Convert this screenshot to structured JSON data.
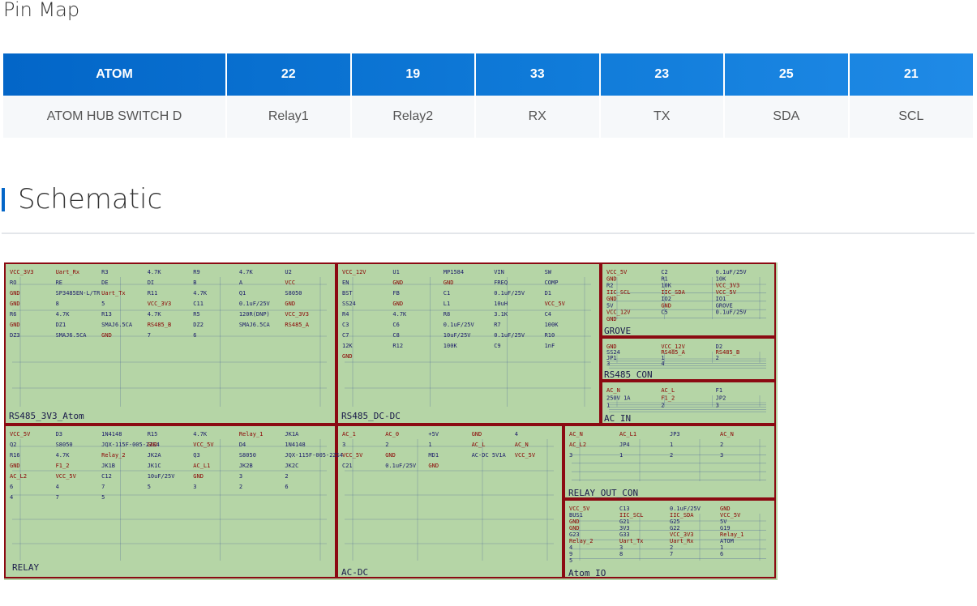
{
  "pin_map": {
    "title": "Pin Map",
    "headers": [
      "ATOM",
      "22",
      "19",
      "33",
      "23",
      "25",
      "21"
    ],
    "row": [
      "ATOM HUB SWITCH D",
      "Relay1",
      "Relay2",
      "RX",
      "TX",
      "SDA",
      "SCL"
    ]
  },
  "schematic_section": {
    "heading": "Schematic"
  },
  "colors": {
    "accent": "#0366c8",
    "schematic_bg": "#b5d5a6",
    "schematic_border": "#8b0a12",
    "wire": "#0a1f8f",
    "net_label": "#8b0000"
  },
  "schematic": {
    "rs485_3v3": {
      "title": "RS485_3V3_Atom",
      "labels": [
        "VCC_3V3",
        "Uart_Rx",
        "R3",
        "4.7K",
        "R9",
        "4.7K",
        "U2",
        "RO",
        "RE",
        "DE",
        "DI",
        "B",
        "A",
        "VCC",
        "GND",
        "SP3485EN-L/TR",
        "Uart_Tx",
        "R11",
        "4.7K",
        "Q1",
        "S8050",
        "GND",
        "8",
        "5",
        "VCC_3V3",
        "C11",
        "0.1uF/25V",
        "GND",
        "R6",
        "4.7K",
        "R13",
        "4.7K",
        "R5",
        "120R(DNP)",
        "VCC_3V3",
        "GND",
        "DZ1",
        "SMAJ6.5CA",
        "RS485_B",
        "DZ2",
        "SMAJ6.5CA",
        "RS485_A",
        "DZ3",
        "SMAJ6.5CA",
        "GND",
        "7",
        "6"
      ]
    },
    "rs485_dcdc": {
      "title": "RS485_DC-DC",
      "labels": [
        "VCC_12V",
        "U1",
        "MP1584",
        "VIN",
        "SW",
        "EN",
        "GND",
        "GND",
        "FREQ",
        "COMP",
        "BST",
        "FB",
        "C1",
        "0.1uF/25V",
        "D1",
        "SS24",
        "GND",
        "L1",
        "10uH",
        "VCC_5V",
        "R4",
        "4.7K",
        "R8",
        "3.1K",
        "C4",
        "C3",
        "C6",
        "0.1uF/25V",
        "R7",
        "100K",
        "C7",
        "C8",
        "10uF/25V",
        "0.1uF/25V",
        "R10",
        "12K",
        "R12",
        "100K",
        "C9",
        "1nF",
        "GND"
      ]
    },
    "grove": {
      "title": "GROVE",
      "labels": [
        "VCC_5V",
        "C2",
        "0.1uF/25V",
        "GND",
        "R1",
        "10K",
        "R2",
        "10K",
        "VCC_3V3",
        "IIC_SCL",
        "IIC_SDA",
        "VCC_5V",
        "GND",
        "IO2",
        "IO1",
        "5V",
        "GND",
        "GROVE",
        "VCC_12V",
        "C5",
        "0.1uF/25V",
        "GND"
      ]
    },
    "rs485_con": {
      "title": "RS485_CON",
      "labels": [
        "GND",
        "VCC_12V",
        "D2",
        "SS24",
        "RS485_A",
        "RS485_B",
        "JP1",
        "1",
        "2",
        "3",
        "4"
      ]
    },
    "ac_in": {
      "title": "AC_IN",
      "labels": [
        "AC_N",
        "AC_L",
        "F1",
        "250V 1A",
        "F1_2",
        "JP2",
        "1",
        "2",
        "3"
      ]
    },
    "relay": {
      "title": "RELAY",
      "labels": [
        "VCC_5V",
        "D3",
        "1N4148",
        "R15",
        "4.7K",
        "Relay_1",
        "JK1A",
        "Q2",
        "S8050",
        "JQX-115F-005-2ZS4",
        "GND",
        "VCC_5V",
        "D4",
        "1N4148",
        "R16",
        "4.7K",
        "Relay_2",
        "JK2A",
        "Q3",
        "S8050",
        "JQX-115F-005-2ZS4",
        "GND",
        "F1_2",
        "JK1B",
        "JK1C",
        "AC_L1",
        "JK2B",
        "JK2C",
        "AC_L2",
        "VCC_5V",
        "C12",
        "10uF/25V",
        "GND",
        "3",
        "2",
        "6",
        "4",
        "7",
        "5",
        "3",
        "2",
        "6",
        "4",
        "7",
        "5"
      ]
    },
    "ac_dc": {
      "title": "AC-DC",
      "labels": [
        "AC_1",
        "AC_0",
        "+5V",
        "GND",
        "4",
        "3",
        "2",
        "1",
        "AC_L",
        "AC_N",
        "VCC_5V",
        "GND",
        "MD1",
        "AC-DC 5V1A",
        "VCC_5V",
        "C21",
        "0.1uF/25V",
        "GND"
      ]
    },
    "relay_out": {
      "title": "RELAY_OUT_CON",
      "labels": [
        "AC_N",
        "AC_L1",
        "JP3",
        "AC_N",
        "AC_L2",
        "JP4",
        "1",
        "2",
        "3",
        "1",
        "2",
        "3"
      ]
    },
    "atom_io": {
      "title": "Atom_IO",
      "labels": [
        "VCC_5V",
        "C13",
        "0.1uF/25V",
        "GND",
        "BUS1",
        "IIC_SCL",
        "IIC_SDA",
        "VCC_5V",
        "GND",
        "G21",
        "G25",
        "5V",
        "GND",
        "3V3",
        "G22",
        "G19",
        "G23",
        "G33",
        "VCC_3V3",
        "Relay_1",
        "Relay_2",
        "Uart_Tx",
        "Uart_Rx",
        "ATOM",
        "4",
        "3",
        "2",
        "1",
        "9",
        "8",
        "7",
        "6",
        "5"
      ]
    }
  }
}
